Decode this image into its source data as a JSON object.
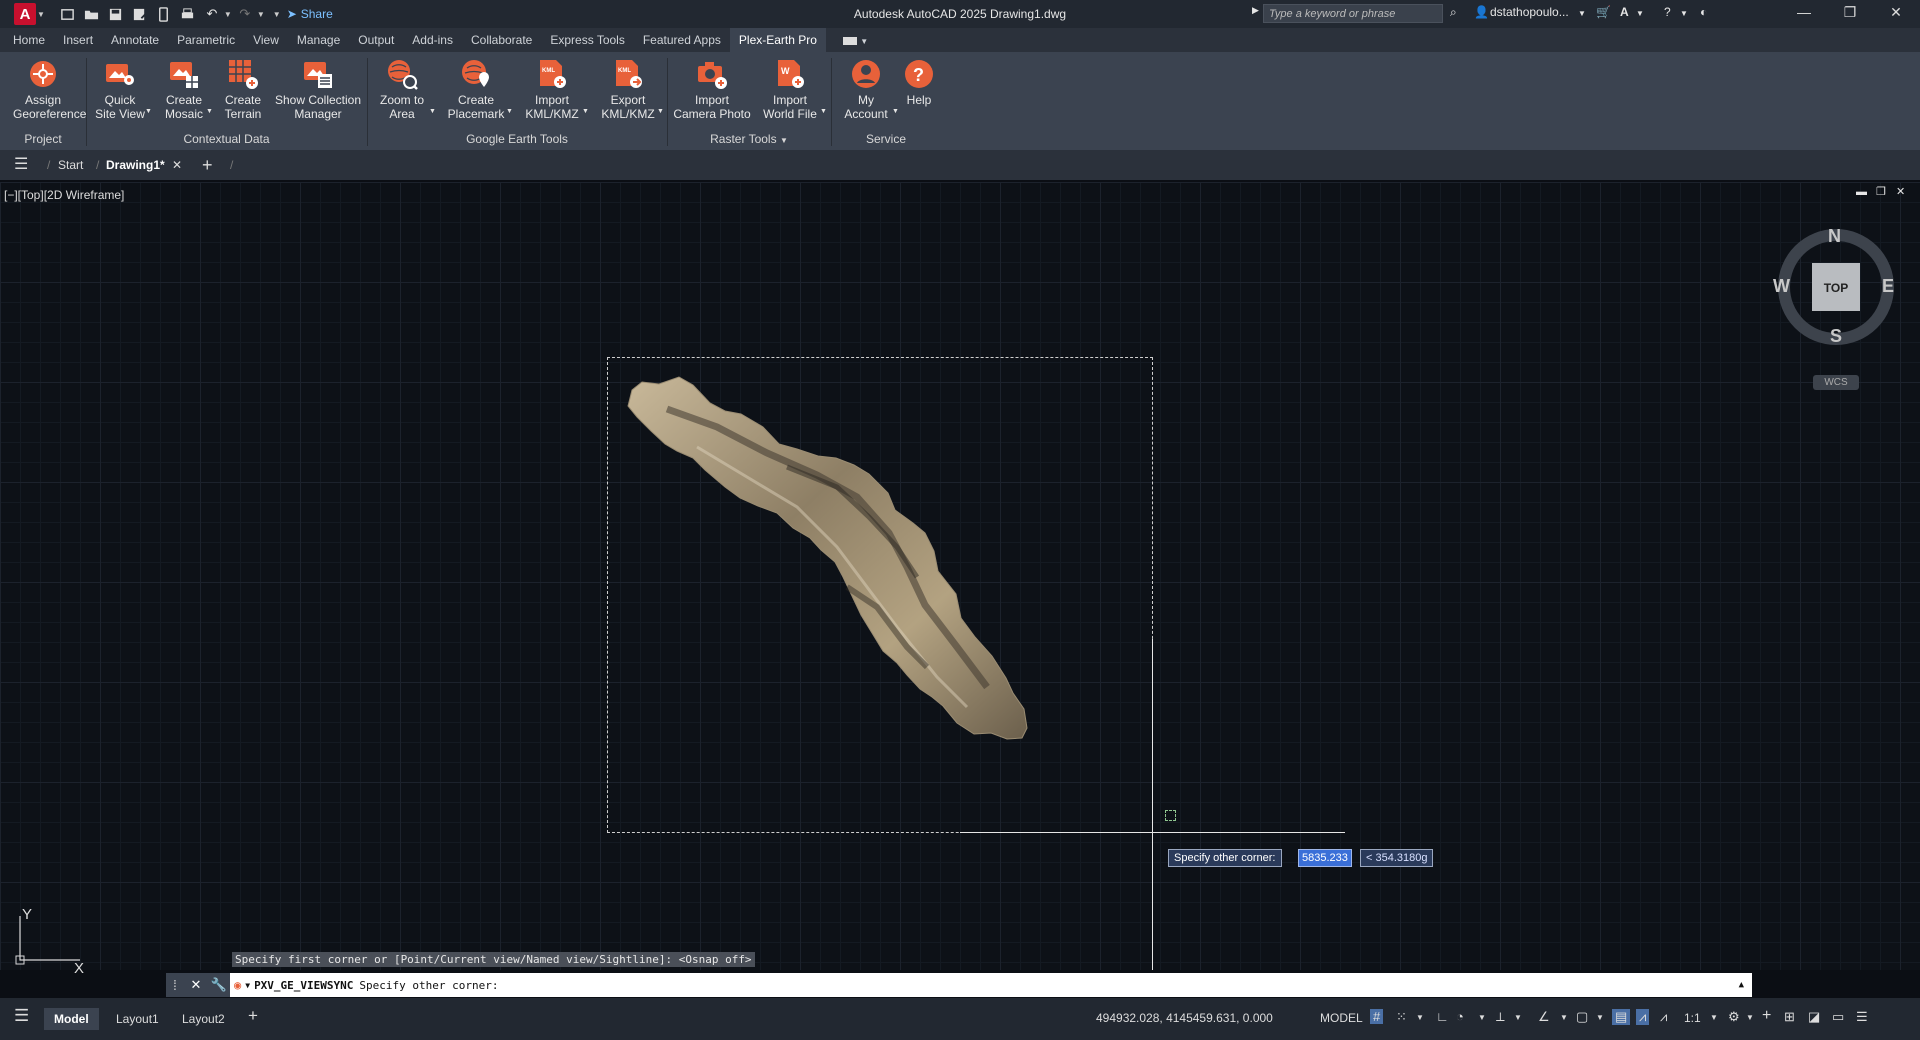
{
  "titlebar": {
    "logo": "A",
    "share_label": "Share",
    "app_title": "Autodesk AutoCAD 2025   Drawing1.dwg",
    "search_placeholder": "Type a keyword or phrase",
    "user": "dstathopoulo...",
    "icons": [
      "new-file-icon",
      "open-icon",
      "save-icon",
      "save-as-icon",
      "web-mobile-icon",
      "plot-icon",
      "undo-icon",
      "redo-icon",
      "share-icon"
    ]
  },
  "ribbon_tabs": [
    "Home",
    "Insert",
    "Annotate",
    "Parametric",
    "View",
    "Manage",
    "Output",
    "Add-ins",
    "Collaborate",
    "Express Tools",
    "Featured Apps",
    "Plex-Earth Pro"
  ],
  "active_tab": "Plex-Earth Pro",
  "ribbon": {
    "buttons": {
      "assign": "Assign Georeference",
      "quick": "Quick Site View",
      "mosaic": "Create Mosaic",
      "terrain": "Create Terrain",
      "collection": "Show Collection Manager",
      "zoom": "Zoom to Area",
      "placemark": "Create Placemark",
      "import_kml": "Import KML/KMZ",
      "export_kml": "Export KML/KMZ",
      "camera": "Import Camera Photo",
      "world": "Import World File",
      "account": "My Account",
      "help": "Help"
    },
    "panels": {
      "project": "Project",
      "contextual": "Contextual Data",
      "google": "Google Earth Tools",
      "raster": "Raster Tools",
      "service": "Service"
    },
    "accent_color": "#e8613a"
  },
  "doc_tabs": {
    "start": "Start",
    "drawing": "Drawing1*"
  },
  "viewport": {
    "label": "[−][Top][2D Wireframe]",
    "viewcube": {
      "top": "TOP",
      "n": "N",
      "s": "S",
      "e": "E",
      "w": "W",
      "wcs": "WCS"
    },
    "ucs": {
      "y": "Y",
      "x": "X"
    }
  },
  "dynamic_input": {
    "prompt": "Specify other corner:",
    "distance": "5835.233",
    "angle": "< 354.3180g"
  },
  "command": {
    "history": "Specify first corner or [Point/Current view/Named view/Sightline]:  <Osnap off>",
    "command_name": "PXV_GE_VIEWSYNC",
    "prompt": "Specify other corner:"
  },
  "status": {
    "layout_tabs": [
      "Model",
      "Layout1",
      "Layout2"
    ],
    "coordinates": "494932.028, 4145459.631, 0.000",
    "model": "MODEL",
    "scale": "1:1"
  }
}
